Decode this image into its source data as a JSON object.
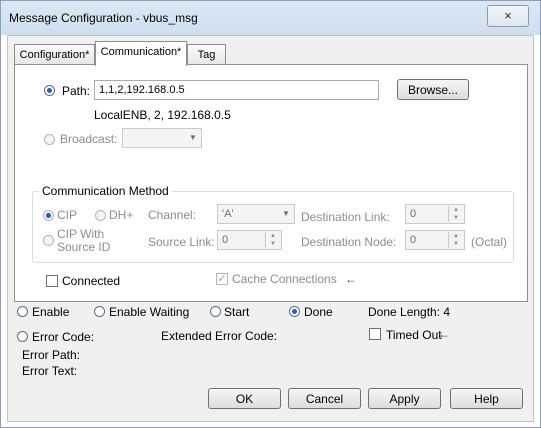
{
  "window": {
    "title": "Message Configuration - vbus_msg",
    "close_glyph": "×"
  },
  "tabs": [
    {
      "label": "Configuration*"
    },
    {
      "label": "Communication*"
    },
    {
      "label": "Tag"
    }
  ],
  "path": {
    "label": "Path:",
    "value": "1,1,2,192.168.0.5",
    "resolved": "LocalENB, 2, 192.168.0.5",
    "browse_label": "Browse..."
  },
  "broadcast": {
    "label": "Broadcast:",
    "value": ""
  },
  "comm_method": {
    "title": "Communication Method",
    "cip": "CIP",
    "dh_plus": "DH+",
    "channel_label": "Channel:",
    "channel_value": "'A'",
    "dest_link_label": "Destination Link:",
    "dest_link_value": "0",
    "cip_source_line1": "CIP With",
    "cip_source_line2": "Source ID",
    "source_link_label": "Source Link:",
    "source_link_value": "0",
    "dest_node_label": "Destination Node:",
    "dest_node_value": "0",
    "octal_label": "(Octal)"
  },
  "connected_label": "Connected",
  "cache_label": "Cache Connections",
  "status": {
    "enable": "Enable",
    "enable_waiting": "Enable Waiting",
    "start": "Start",
    "done": "Done",
    "done_length": "Done Length: 4",
    "error_code": "Error Code:",
    "extended_error_code": "Extended Error Code:",
    "timed_out": "Timed Out",
    "error_path": "Error Path:",
    "error_text": "Error Text:"
  },
  "buttons": {
    "ok": "OK",
    "cancel": "Cancel",
    "apply": "Apply",
    "help": "Help"
  },
  "arrow_glyph": "←"
}
